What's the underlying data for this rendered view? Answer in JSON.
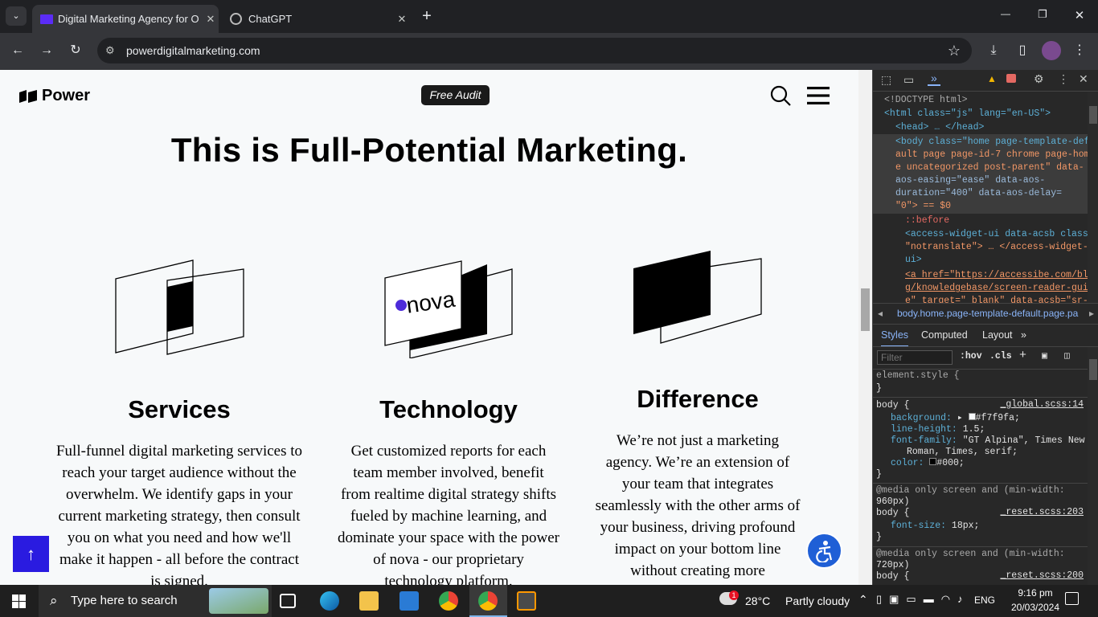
{
  "browser": {
    "tabs": [
      {
        "label": "Digital Marketing Agency for O",
        "icon": "power-favicon-icon",
        "active": true
      },
      {
        "label": "ChatGPT",
        "icon": "chatgpt-icon",
        "active": false
      }
    ],
    "new_tab": "+",
    "url": "powerdigitalmarketing.com",
    "window_controls": {
      "minimize": "—",
      "maximize": "❐",
      "close": "✕"
    }
  },
  "site": {
    "logo_text": "Power",
    "free_audit": "Free Audit",
    "hero_title": "This is Full-Potential Marketing.",
    "columns": [
      {
        "title": "Services",
        "text": "Full-funnel digital marketing services to reach your target audience without the overwhelm. We identify gaps in your current marketing strategy, then consult you on what you need and how we'll make it happen - all before the contract is signed."
      },
      {
        "title": "Technology",
        "logo_text": "nova",
        "text": "Get customized reports for each team member involved, benefit from realtime digital strategy shifts fueled by machine learning, and dominate your space with the power of nova - our proprietary technology platform."
      },
      {
        "title": "Difference",
        "text": "We’re not just a marketing agency. We’re an extension of your team that integrates seamlessly with the other arms of your business, driving profound impact on your bottom line without creating more"
      }
    ],
    "scroll_up": "↑"
  },
  "devtools": {
    "doctype": "<!DOCTYPE html>",
    "html_tag": "<html class=\"js\" lang=\"en-US\">",
    "head_tag": "<head> … </head>",
    "body_lines": [
      "<body class=\"home page-template-def",
      "ault page page-id-7 chrome page-hom",
      "e uncategorized post-parent\" data-",
      "aos-easing=\"ease\" data-aos-",
      "duration=\"400\" data-aos-delay=",
      "\"0\"> == $0"
    ],
    "before": "::before",
    "access_lines": [
      "<access-widget-ui data-acsb class=",
      "\"notranslate\"> … </access-widget-",
      "ui>"
    ],
    "a_lines": [
      "<a href=\"https://accessibe.com/blo",
      "g/knowledgebase/screen-reader-guid",
      "e\" target=\"_blank\" data-acsb=\"sr-t"
    ],
    "breadcrumb": "body.home.page-template-default.page.pa",
    "panel_tabs": [
      "Styles",
      "Computed",
      "Layout"
    ],
    "filter_placeholder": "Filter",
    "hov": ":hov",
    "cls": ".cls",
    "rules": [
      {
        "selector": "element.style {",
        "close": "}"
      },
      {
        "selector": "body {",
        "source": "_global.scss:14",
        "props": [
          [
            "background:",
            "#f7f9fa;"
          ],
          [
            "line-height:",
            "1.5;"
          ],
          [
            "font-family:",
            "\"GT Alpina\", Times New"
          ],
          [
            "",
            "Roman, Times, serif;"
          ],
          [
            "color:",
            "#000;"
          ]
        ],
        "close": "}"
      },
      {
        "media": "@media only screen and (min-width:",
        "media2": "960px)",
        "selector": "body {",
        "source": "_reset.scss:203",
        "props": [
          [
            "font-size:",
            "18px;"
          ]
        ],
        "close": "}"
      },
      {
        "media": "@media only screen and (min-width:",
        "media2": "720px)",
        "selector": "body {",
        "source": "_reset.scss:200"
      }
    ]
  },
  "taskbar": {
    "search_placeholder": "Type here to search",
    "weather_temp": "28°C",
    "weather_text": "Partly cloudy",
    "weather_badge": "1",
    "language": "ENG",
    "time": "9:16 pm",
    "date": "20/03/2024"
  },
  "colors": {
    "accent_blue": "#2a1be0",
    "access_blue": "#1f5fd6",
    "page_bg": "#f7f9fa"
  }
}
